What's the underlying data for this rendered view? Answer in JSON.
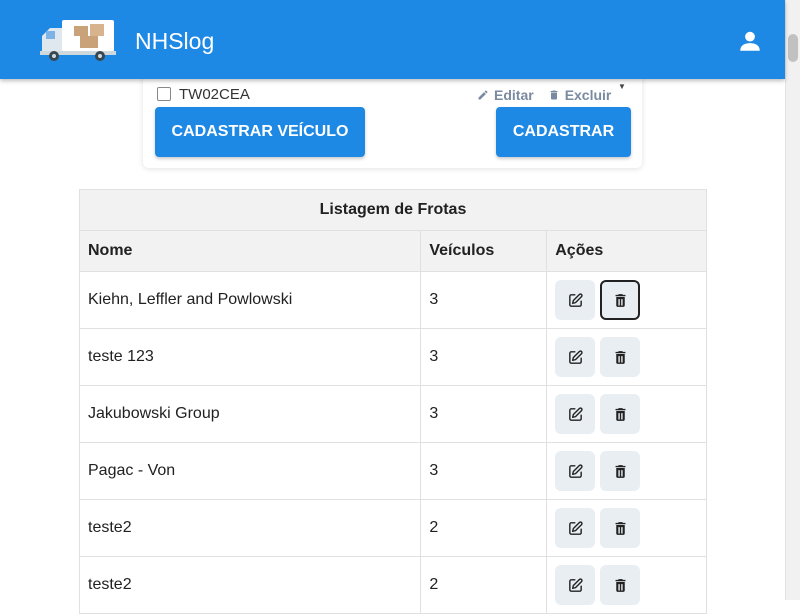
{
  "app": {
    "title": "NHSlog",
    "logo_icon": "delivery-truck-logo",
    "account_icon": "account-icon"
  },
  "colors": {
    "primary": "#1e88e5",
    "header_bg": "#f2f2f2",
    "icon_button_bg": "#e9eef3"
  },
  "vehicle_form": {
    "partial_row": {
      "plate": "TW02CEA",
      "edit_label": "Editar",
      "delete_label": "Excluir"
    },
    "register_vehicle_label": "CADASTRAR VEÍCULO",
    "register_label": "CADASTRAR"
  },
  "fleet_table": {
    "caption": "Listagem de Frotas",
    "columns": [
      "Nome",
      "Veículos",
      "Ações"
    ],
    "rows": [
      {
        "name": "Kiehn, Leffler and Powlowski",
        "vehicles": "3"
      },
      {
        "name": "teste 123",
        "vehicles": "3"
      },
      {
        "name": "Jakubowski Group",
        "vehicles": "3"
      },
      {
        "name": "Pagac - Von",
        "vehicles": "3"
      },
      {
        "name": "teste2",
        "vehicles": "2"
      },
      {
        "name": "teste2",
        "vehicles": "2"
      }
    ],
    "row_action_icons": [
      "edit-icon",
      "trash-icon"
    ],
    "focused_row_index": 0
  }
}
